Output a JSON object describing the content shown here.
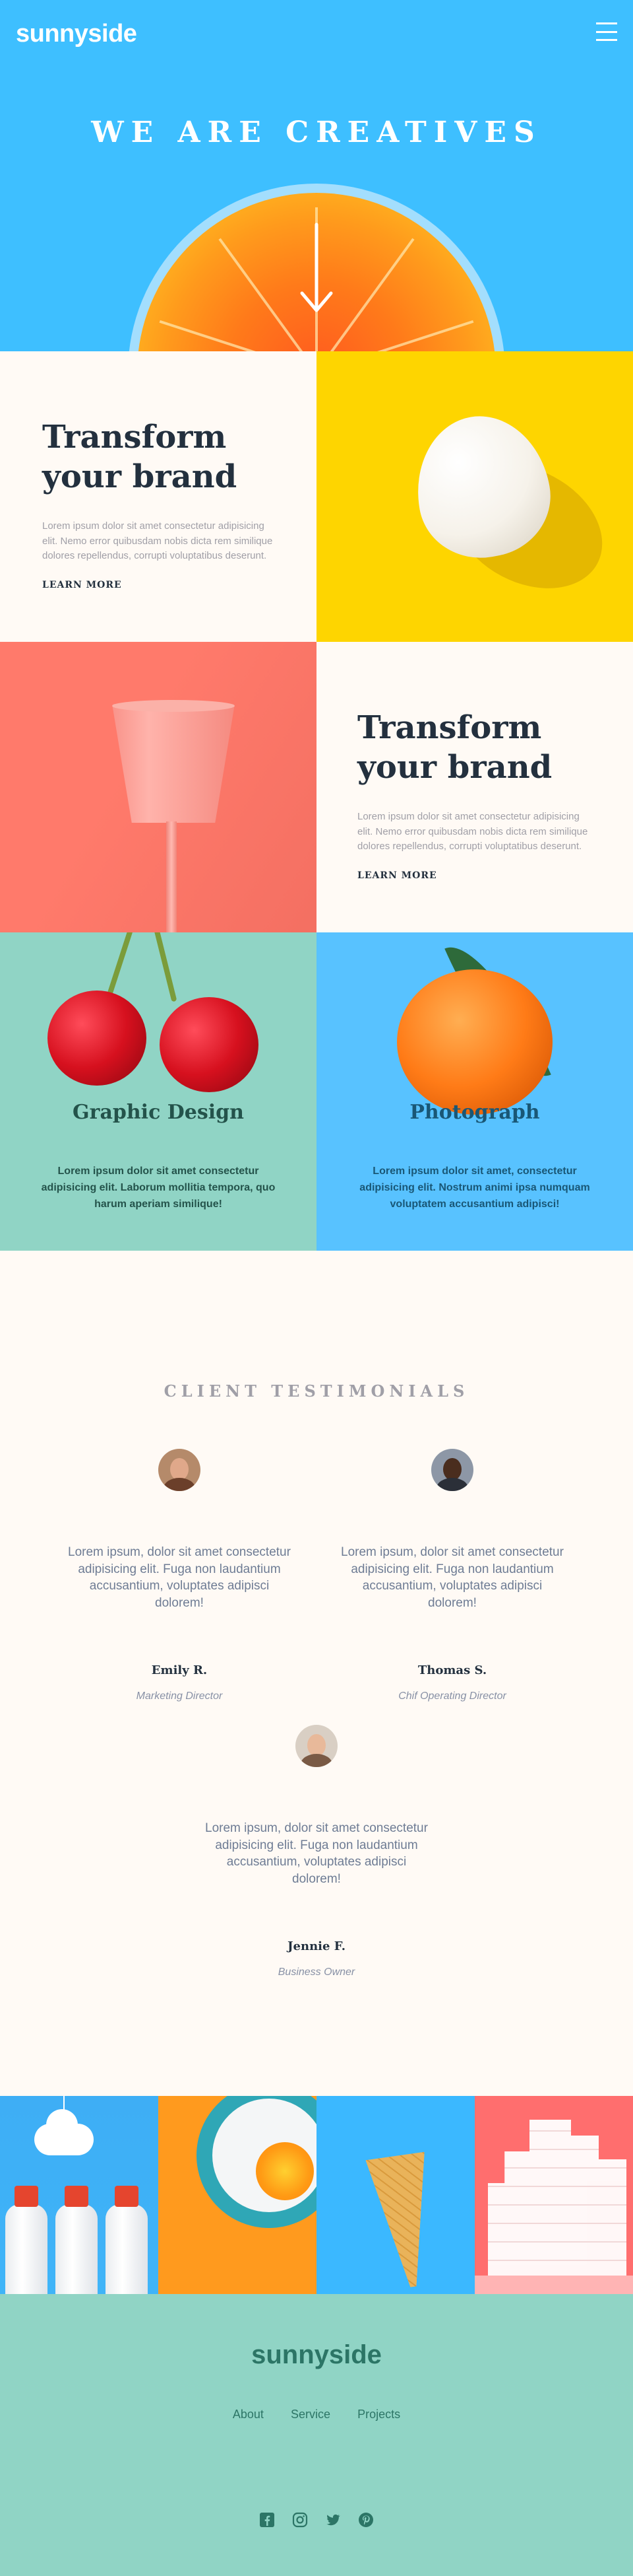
{
  "header": {
    "logo": "sunnyside",
    "menu_icon": "hamburger-menu-icon",
    "hero_title": "WE ARE CREATIVES",
    "scroll_icon": "arrow-down-icon"
  },
  "features": [
    {
      "title_line1": "Transform",
      "title_line2": "your brand",
      "body": "Lorem ipsum dolor sit amet consectetur adipisicing elit. Nemo error quibusdam nobis dicta rem similique dolores repellendus, corrupti voluptatibus deserunt.",
      "link": "LEARN MORE",
      "link_highlight_color": "#fed500",
      "image": "egg"
    },
    {
      "title_line1": "Transform",
      "title_line2": "your brand",
      "body": "Lorem ipsum dolor sit amet consectetur adipisicing elit. Nemo error quibusdam nobis dicta rem similique dolores repellendus, corrupti voluptatibus deserunt.",
      "link": "LEARN MORE",
      "link_highlight_color": "#ff7a6b",
      "image": "pink-glass"
    }
  ],
  "services": [
    {
      "title": "Graphic Design",
      "body": "Lorem ipsum dolor sit amet consectetur adipisicing elit. Laborum mollitia tempora, quo harum aperiam similique!",
      "image": "cherries",
      "bg_color": "#90d4c5"
    },
    {
      "title": "Photograph",
      "body": "Lorem ipsum dolor sit amet, consectetur adipisicing elit. Nostrum animi ipsa numquam voluptatem accusantium adipisci!",
      "image": "orange",
      "bg_color": "#58c2ff"
    }
  ],
  "testimonials": {
    "heading": "CLIENT TESTIMONIALS",
    "items": [
      {
        "quote": "Lorem ipsum, dolor sit amet consectetur adipisicing elit. Fuga non laudantium accusantium, voluptates adipisci dolorem!",
        "name": "Emily R.",
        "role": "Marketing Director"
      },
      {
        "quote": "Lorem ipsum, dolor sit amet consectetur adipisicing elit. Fuga non laudantium accusantium, voluptates adipisci dolorem!",
        "name": "Thomas S.",
        "role": "Chif Operating Director"
      },
      {
        "quote": "Lorem ipsum, dolor sit amet consectetur adipisicing elit. Fuga non laudantium accusantium, voluptates adipisci dolorem!",
        "name": "Jennie F.",
        "role": "Business Owner"
      }
    ]
  },
  "gallery": [
    "milk-bottles",
    "orange-plate",
    "ice-cream-cone",
    "sugar-cubes"
  ],
  "footer": {
    "logo": "sunnyside",
    "nav": [
      "About",
      "Service",
      "Projects"
    ],
    "social_icons": [
      "facebook-icon",
      "instagram-icon",
      "twitter-icon",
      "pinterest-icon"
    ]
  },
  "colors": {
    "hero_blue": "#3ebfff",
    "yellow": "#fed500",
    "coral": "#ff7a6b",
    "mint": "#90d4c5",
    "sky": "#58c2ff",
    "dark_text": "#23303e",
    "footer_text": "#2c7566"
  }
}
